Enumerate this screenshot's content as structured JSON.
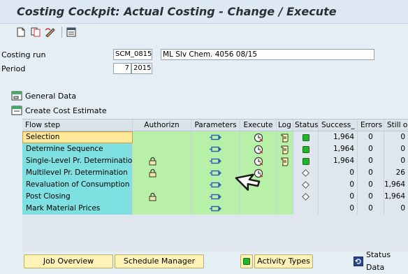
{
  "window": {
    "title": "Costing Cockpit: Actual Costing - Change / Execute"
  },
  "toolbar": {
    "icons": [
      "new-icon",
      "copy-icon",
      "edit-icon",
      "info-icon"
    ]
  },
  "form": {
    "costing_run_label": "Costing run",
    "costing_run_value": "SCM_0815",
    "costing_run_desc": "ML Slv Chem. 4056 08/15",
    "period_label": "Period",
    "period_value": "7",
    "year_value": "2015"
  },
  "sections": {
    "general_data": "General Data",
    "create_cost_estimate": "Create Cost Estimate"
  },
  "grid": {
    "headers": {
      "flow_step": "Flow step",
      "authorization": "Authorizn",
      "parameters": "Parameters",
      "execute": "Execute",
      "log": "Log",
      "status": "Status",
      "success": "Success_",
      "errors": "Errors",
      "still_open": "Still open"
    },
    "rows": [
      {
        "step": "Selection",
        "lock": false,
        "execute": true,
        "log": true,
        "status": "green",
        "success": "1,964",
        "errors": "0",
        "still_open": "0"
      },
      {
        "step": "Determine Sequence",
        "lock": false,
        "execute": true,
        "log": true,
        "status": "green",
        "success": "1,964",
        "errors": "0",
        "still_open": "0"
      },
      {
        "step": "Single-Level Pr. Determination",
        "lock": true,
        "execute": true,
        "log": true,
        "status": "green",
        "success": "1,964",
        "errors": "0",
        "still_open": "0"
      },
      {
        "step": "Multilevel Pr. Determination",
        "lock": true,
        "execute": true,
        "log": false,
        "status": "diamond",
        "success": "0",
        "errors": "0",
        "still_open": "26"
      },
      {
        "step": "Revaluation of Consumption",
        "lock": false,
        "execute": false,
        "log": false,
        "status": "diamond",
        "success": "0",
        "errors": "0",
        "still_open": "1,964"
      },
      {
        "step": "Post Closing",
        "lock": true,
        "execute": false,
        "log": false,
        "status": "diamond",
        "success": "0",
        "errors": "0",
        "still_open": "1,964"
      },
      {
        "step": "Mark Material Prices",
        "lock": false,
        "execute": false,
        "log": false,
        "status": "",
        "success": "0",
        "errors": "0",
        "still_open": "0"
      }
    ]
  },
  "buttons": {
    "job_overview": "Job Overview",
    "schedule_manager": "Schedule Manager",
    "activity_types": "Activity Types",
    "status_data": "Status Data"
  }
}
